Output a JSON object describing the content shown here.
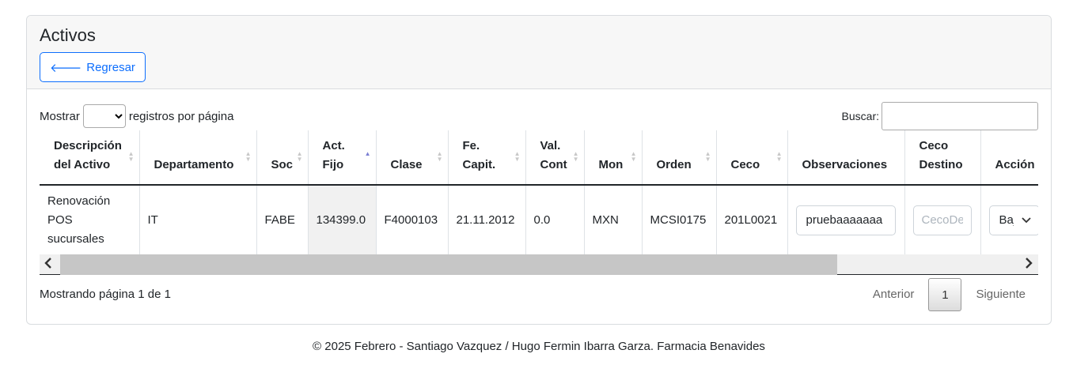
{
  "card": {
    "title": "Activos",
    "back_label": "Regresar"
  },
  "length": {
    "prefix": "Mostrar",
    "suffix": "registros por página",
    "selected": ""
  },
  "search": {
    "label": "Buscar:",
    "value": ""
  },
  "table": {
    "headers": [
      "Descripción del Activo",
      "Departamento",
      "Soc",
      "Act. Fijo",
      "Clase",
      "Fe. Capit.",
      "Val. Cont",
      "Mon",
      "Orden",
      "Ceco",
      "Observaciones",
      "Ceco Destino",
      "Acción"
    ],
    "row": {
      "descripcion": "Renovación POS sucursales",
      "departamento": "IT",
      "soc": "FABE",
      "act_fijo": "134399.0",
      "clase": "F4000103",
      "fe_capit": "21.11.2012",
      "val_cont": "0.0",
      "mon": "MXN",
      "orden": "MCSI0175",
      "ceco": "201L0021",
      "observaciones": "pruebaaaaaaa",
      "ceco_destino_placeholder": "CecoDestino",
      "accion": "Baja"
    }
  },
  "footer_row": {
    "info": "Mostrando página 1 de 1",
    "prev": "Anterior",
    "page": "1",
    "next": "Siguiente"
  },
  "site_footer": "© 2025 Febrero - Santiago Vazquez / Hugo Fermin Ibarra Garza. Farmacia Benavides",
  "colors": {
    "primary": "#0d6efd",
    "header_bg": "#f7f7f7",
    "sort_active": "#7b7fd4"
  }
}
